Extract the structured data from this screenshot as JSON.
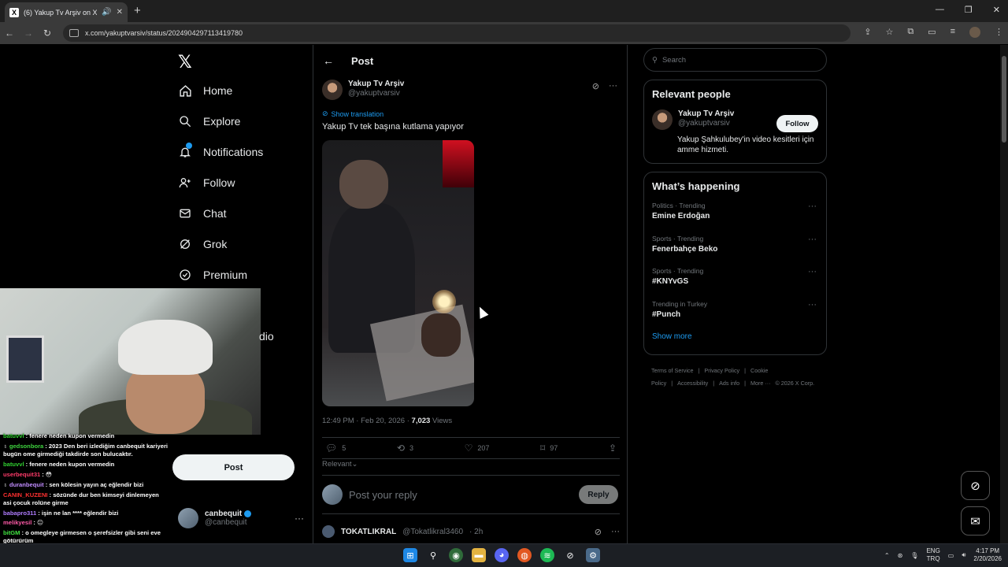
{
  "browser": {
    "tab_title": "(6) Yakup Tv Arşiv on X: \"Ya",
    "tab_favicon": "X",
    "url": "x.com/yakuptvarsiv/status/2024904297113419780"
  },
  "nav": {
    "items": [
      {
        "label": "Home",
        "icon": "home-icon"
      },
      {
        "label": "Explore",
        "icon": "search-icon"
      },
      {
        "label": "Notifications",
        "icon": "bell-icon"
      },
      {
        "label": "Follow",
        "icon": "person-add-icon"
      },
      {
        "label": "Chat",
        "icon": "mail-icon"
      },
      {
        "label": "Grok",
        "icon": "grok-icon"
      },
      {
        "label": "Premium",
        "icon": "verified-badge-icon"
      }
    ],
    "hidden_partial": "dio",
    "post_button": "Post",
    "account": {
      "name": "canbequit",
      "handle": "@canbequit"
    }
  },
  "chat_overlay": [
    {
      "user": "batuvvl",
      "color": "#31d031",
      "text": "fenere neden kupon vermedin"
    },
    {
      "user": "gedsonbora",
      "color": "#3fd43f",
      "badge": true,
      "text": "2023 Den beri izlediğim canbequit kariyeri bugün ome girmediği takdirde son bulucaktır."
    },
    {
      "user": "batuvvl",
      "color": "#31d031",
      "text": "fenere neden kupon vermedin"
    },
    {
      "user": "userbequit31",
      "color": "#ff3b6a",
      "text": "😳"
    },
    {
      "user": "duranbequit",
      "color": "#c18cff",
      "badge": true,
      "text": "sen kölesin yayın aç eğlendir bizi"
    },
    {
      "user": "CANIN_KUZENI",
      "color": "#ff3030",
      "text": "sözünde dur ben kimseyi dinlemeyen asi çocuk rolüne girme"
    },
    {
      "user": "babapro311",
      "color": "#b07cff",
      "text": "işin ne lan **** eğlendir bizi"
    },
    {
      "user": "melikyesil",
      "color": "#ff5aa8",
      "text": "😐"
    },
    {
      "user": "bitGM",
      "color": "#42e642",
      "text": "o omegleye girmesen o şerefsizler gibi seni eve götürürüm"
    }
  ],
  "post": {
    "header_title": "Post",
    "author_name": "Yakup Tv Arşiv",
    "author_handle": "@yakuptvarsiv",
    "show_translation": "Show translation",
    "text": "Yakup Tv tek başına kutlama yapıyor",
    "time": "12:49 PM · Feb 20, 2026 · ",
    "views_count": "7,023",
    "views_label": " Views",
    "replies": "5",
    "reposts": "3",
    "likes": "207",
    "bookmarks": "97",
    "sort_label": "Relevant",
    "reply_placeholder": "Post your reply",
    "reply_button": "Reply",
    "first_reply": {
      "name": "TOKATLIKRAL",
      "handle": "@Tokatlikral3460",
      "time": "· 2h"
    }
  },
  "sidebar": {
    "search_placeholder": "Search",
    "relevant_title": "Relevant people",
    "person": {
      "name": "Yakup Tv Arşiv",
      "handle": "@yakuptvarsiv",
      "follow": "Follow",
      "bio": "Yakup Şahkulubey'in video kesitleri için amme hizmeti."
    },
    "happening_title": "What’s happening",
    "trends": [
      {
        "category": "Politics · Trending",
        "title": "Emine Erdoğan"
      },
      {
        "category": "Sports · Trending",
        "title": "Fenerbahçe Beko"
      },
      {
        "category": "Sports · Trending",
        "title": "#KNYvGS"
      },
      {
        "category": "Trending in Turkey",
        "title": "#Punch"
      }
    ],
    "show_more": "Show more",
    "footer": [
      "Terms of Service",
      "|",
      "Privacy Policy",
      "|",
      "Cookie Policy",
      "|",
      "Accessibility",
      "|",
      "Ads info",
      "|",
      "More ···",
      "© 2026 X Corp."
    ]
  },
  "taskbar": {
    "lang_top": "ENG",
    "lang_bottom": "TRQ",
    "time": "4:17 PM",
    "date": "2/20/2026"
  }
}
